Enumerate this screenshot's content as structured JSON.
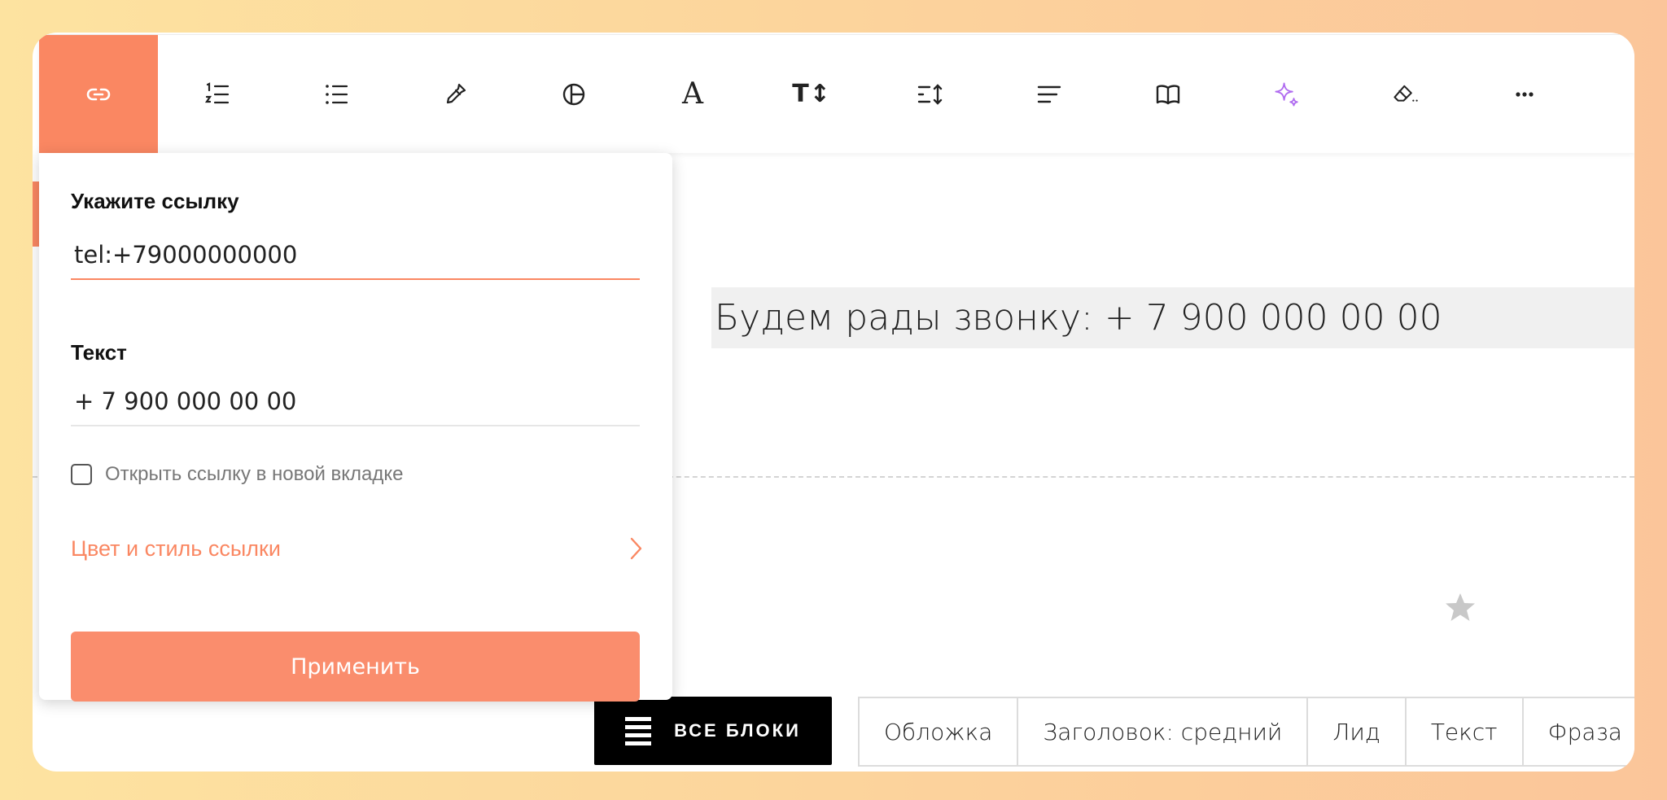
{
  "toolbar": {
    "buttons": [
      {
        "icon": "link-icon"
      },
      {
        "icon": "numbered-list-icon"
      },
      {
        "icon": "bullet-list-icon"
      },
      {
        "icon": "color-picker-icon"
      },
      {
        "icon": "font-style-icon"
      },
      {
        "icon": "font-family-icon",
        "glyph": "A"
      },
      {
        "icon": "font-size-icon",
        "glyph": "T↕"
      },
      {
        "icon": "line-height-icon"
      },
      {
        "icon": "align-left-icon"
      },
      {
        "icon": "typograph-book-icon"
      },
      {
        "icon": "ai-sparkle-icon"
      },
      {
        "icon": "clear-format-icon"
      },
      {
        "icon": "more-icon"
      }
    ]
  },
  "content": {
    "text_block": "Будем рады звонку: + 7 900 000 00 00"
  },
  "popup": {
    "url_label": "Укажите ссылку",
    "url_value": "tel:+79000000000",
    "text_label": "Текст",
    "text_value": "+ 7 900 000 00 00",
    "new_tab_label": "Открыть ссылку в новой вкладке",
    "style_label": "Цвет и стиль ссылки",
    "apply_label": "Применить"
  },
  "bottom_bar": {
    "all_blocks_label": "ВСЕ БЛОКИ",
    "chips": [
      "Обложка",
      "Заголовок: средний",
      "Лид",
      "Текст",
      "Фраза"
    ]
  },
  "colors": {
    "accent": "#fa8762",
    "ai": "#b06cf0"
  }
}
